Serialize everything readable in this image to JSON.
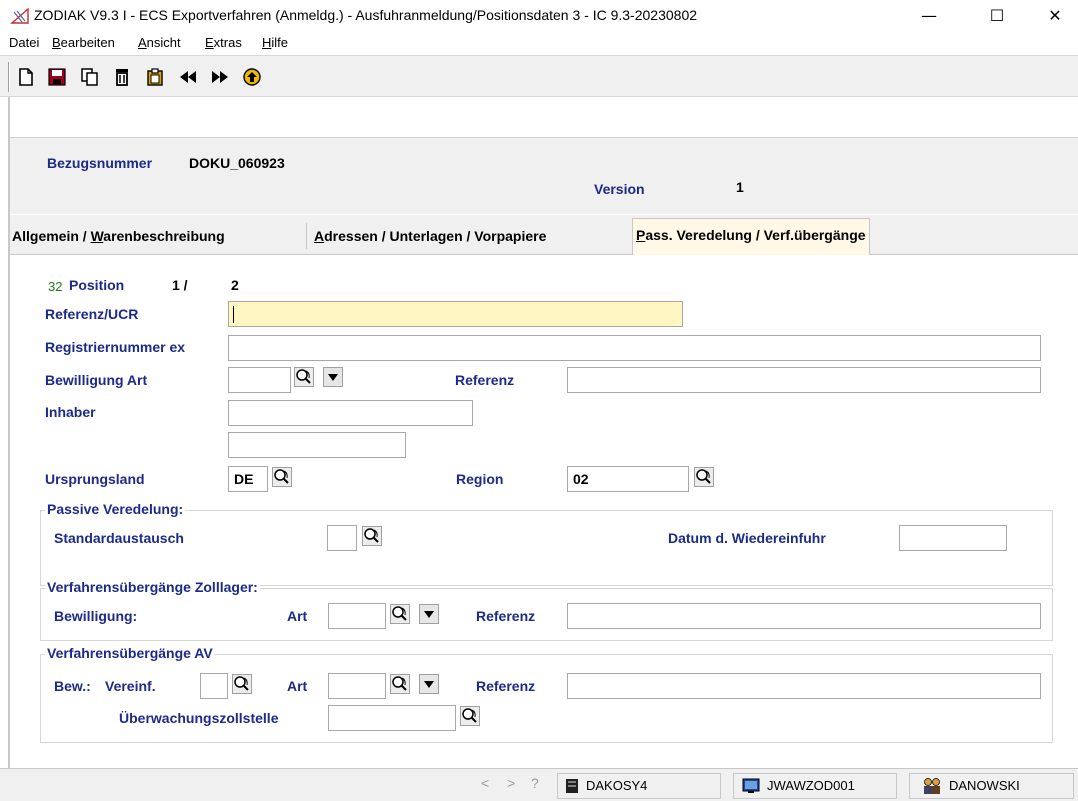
{
  "window": {
    "title": "ZODIAK V9.3 I - ECS Exportverfahren (Anmeldg.) - Ausfuhranmeldung/Positionsdaten 3 - IC 9.3-20230802",
    "minimize": "—",
    "maximize": "☐",
    "close": "✕"
  },
  "menu": {
    "datei": "Datei",
    "bearbeiten_u": "B",
    "bearbeiten_rest": "earbeiten",
    "ansicht_u": "A",
    "ansicht_rest": "nsicht",
    "extras_u": "E",
    "extras_rest": "xtras",
    "hilfe_u": "H",
    "hilfe_rest": "ilfe"
  },
  "toolbar": {
    "icons": [
      "new-document-icon",
      "save-icon",
      "copy-icon",
      "delete-icon",
      "paste-icon",
      "previous-icon",
      "next-icon",
      "exit-icon"
    ]
  },
  "header": {
    "bezugsnummer_label": "Bezugsnummer",
    "bezugsnummer_value": "DOKU_060923",
    "version_label": "Version",
    "version_value": "1"
  },
  "tabs": {
    "allgemein_pre": "Allgemein / ",
    "allgemein_u": "W",
    "allgemein_rest": "arenbeschreibung",
    "adressen_u": "A",
    "adressen_rest": "dressen / Unterlagen / Vorpapiere",
    "pass_u": "P",
    "pass_rest": "ass. Veredelung / Verf.übergänge"
  },
  "position": {
    "code": "32",
    "label": "Position",
    "current": "1 /",
    "total": "2"
  },
  "form": {
    "referenz_ucr_label": "Referenz/UCR",
    "referenz_ucr_value": "",
    "registriernummer_label": "Registriernummer ex",
    "registriernummer_value": "",
    "bewilligung_art_label": "Bewilligung Art",
    "bewilligung_art_value": "",
    "referenz_label": "Referenz",
    "referenz_value": "",
    "inhaber_label": "Inhaber",
    "inhaber_value1": "",
    "inhaber_value2": "",
    "ursprungsland_label": "Ursprungsland",
    "ursprungsland_value": "DE",
    "region_label": "Region",
    "region_value": "02"
  },
  "passive_veredelung": {
    "title": "Passive Veredelung:",
    "standardaustausch_label": "Standardaustausch",
    "standardaustausch_value": "",
    "datum_label": "Datum d. Wiedereinfuhr",
    "datum_value": ""
  },
  "zolllager": {
    "title": "Verfahrensübergänge Zolllager:",
    "bewilligung_label": "Bewilligung:",
    "art_label": "Art",
    "art_value": "",
    "referenz_label": "Referenz",
    "referenz_value": ""
  },
  "av": {
    "title": "Verfahrensübergänge AV",
    "bew_label": "Bew.:",
    "vereinf_label": "Vereinf.",
    "vereinf_value": "",
    "art_label": "Art",
    "art_value": "",
    "referenz_label": "Referenz",
    "referenz_value": "",
    "ueberwachung_label": "Überwachungszollstelle",
    "ueberwachung_value": ""
  },
  "statusbar": {
    "prev": "<",
    "next": ">",
    "help": "?",
    "server": "DAKOSY4",
    "workstation": "JWAWZOD001",
    "user": "DANOWSKI"
  },
  "colors": {
    "label_blue": "#1c2a8a",
    "active_field": "#fff6c2",
    "active_tab": "#fff8e6"
  }
}
